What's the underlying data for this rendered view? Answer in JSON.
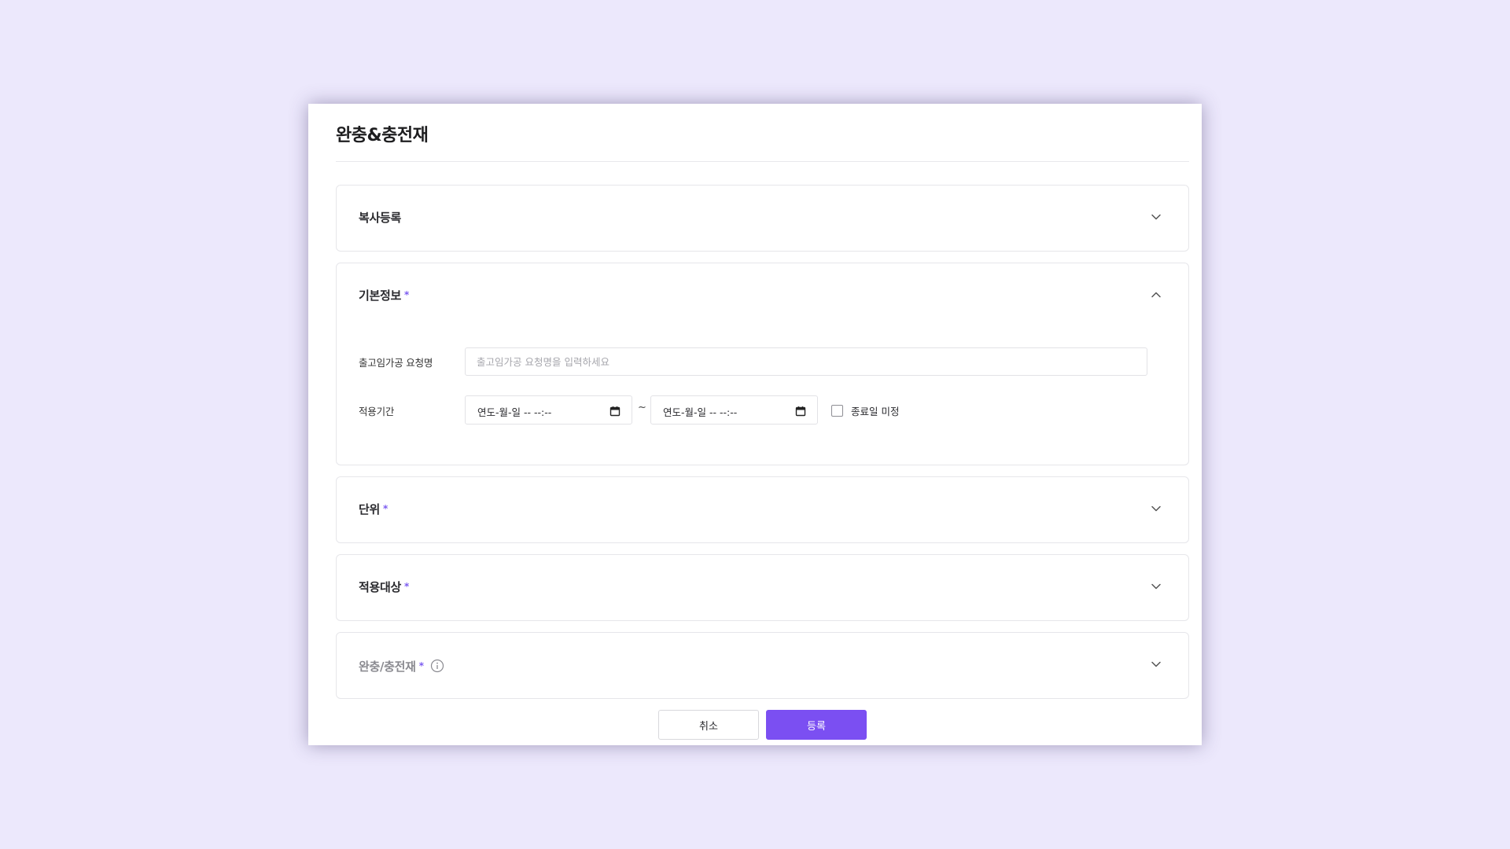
{
  "modal": {
    "title": "완충&충전재"
  },
  "sections": {
    "copy": {
      "label": "복사등록",
      "required": false,
      "expanded": false
    },
    "basic": {
      "label": "기본정보",
      "required": true,
      "required_mark": "*",
      "expanded": true,
      "request_name": {
        "label": "출고임가공 요청명",
        "value": "",
        "placeholder": "출고임가공 요청명을 입력하세요"
      },
      "period": {
        "label": "적용기간",
        "start_display": "연도-월-일 -- --:--",
        "end_display": "연도-월-일 -- --:--",
        "separator": "~",
        "no_end_date_label": "종료일 미정",
        "no_end_date_checked": false
      }
    },
    "unit": {
      "label": "단위",
      "required": true,
      "required_mark": "*",
      "expanded": false
    },
    "target": {
      "label": "적용대상",
      "required": true,
      "required_mark": "*",
      "expanded": false
    },
    "material": {
      "label": "완충/충전재",
      "required": true,
      "required_mark": "*",
      "expanded": false,
      "has_info_icon": true
    }
  },
  "actions": {
    "cancel_label": "취소",
    "submit_label": "등록"
  },
  "colors": {
    "background": "#ece8fc",
    "accent": "#7b4ff2",
    "required_mark": "#7c5cf0",
    "border": "#e6e6ea"
  }
}
